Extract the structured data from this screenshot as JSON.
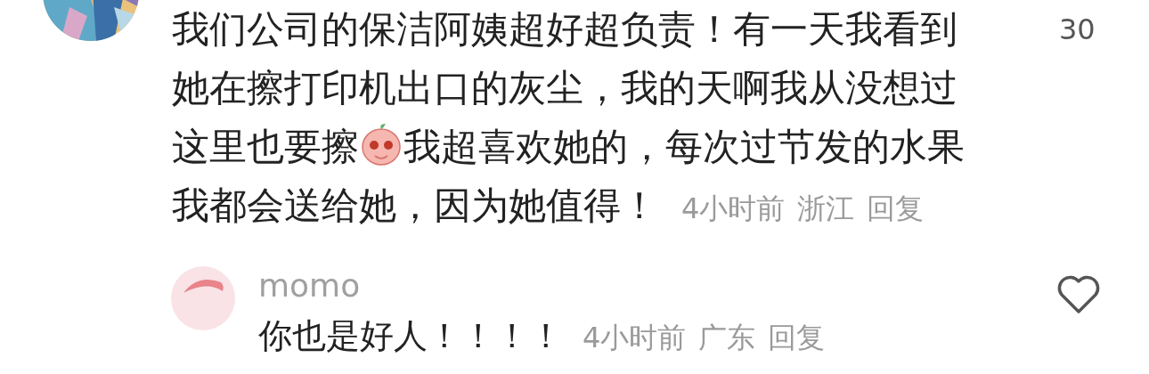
{
  "comment": {
    "avatar": {
      "kind": "picture"
    },
    "lines": [
      [
        {
          "kind": "text",
          "text": "我们公司的保洁阿姨超好超负责！有一天我看到"
        }
      ],
      [
        {
          "kind": "text",
          "text": "她在擦打印机出口的灰尘，我的天啊我从没想过"
        }
      ],
      [
        {
          "kind": "text",
          "text": "这里也要擦"
        },
        {
          "kind": "sticker"
        },
        {
          "kind": "text",
          "text": "我超喜欢她的，每次过节发的水果"
        }
      ],
      [
        {
          "kind": "text",
          "text": "我都会送给她，因为她值得！"
        }
      ]
    ],
    "time": "4小时前",
    "location": "浙江",
    "reply_label": "回复",
    "like_count": "30"
  },
  "reply": {
    "author": "momo",
    "text": "你也是好人！！！！",
    "time": "4小时前",
    "location": "广东",
    "reply_label": "回复",
    "liked": false
  }
}
